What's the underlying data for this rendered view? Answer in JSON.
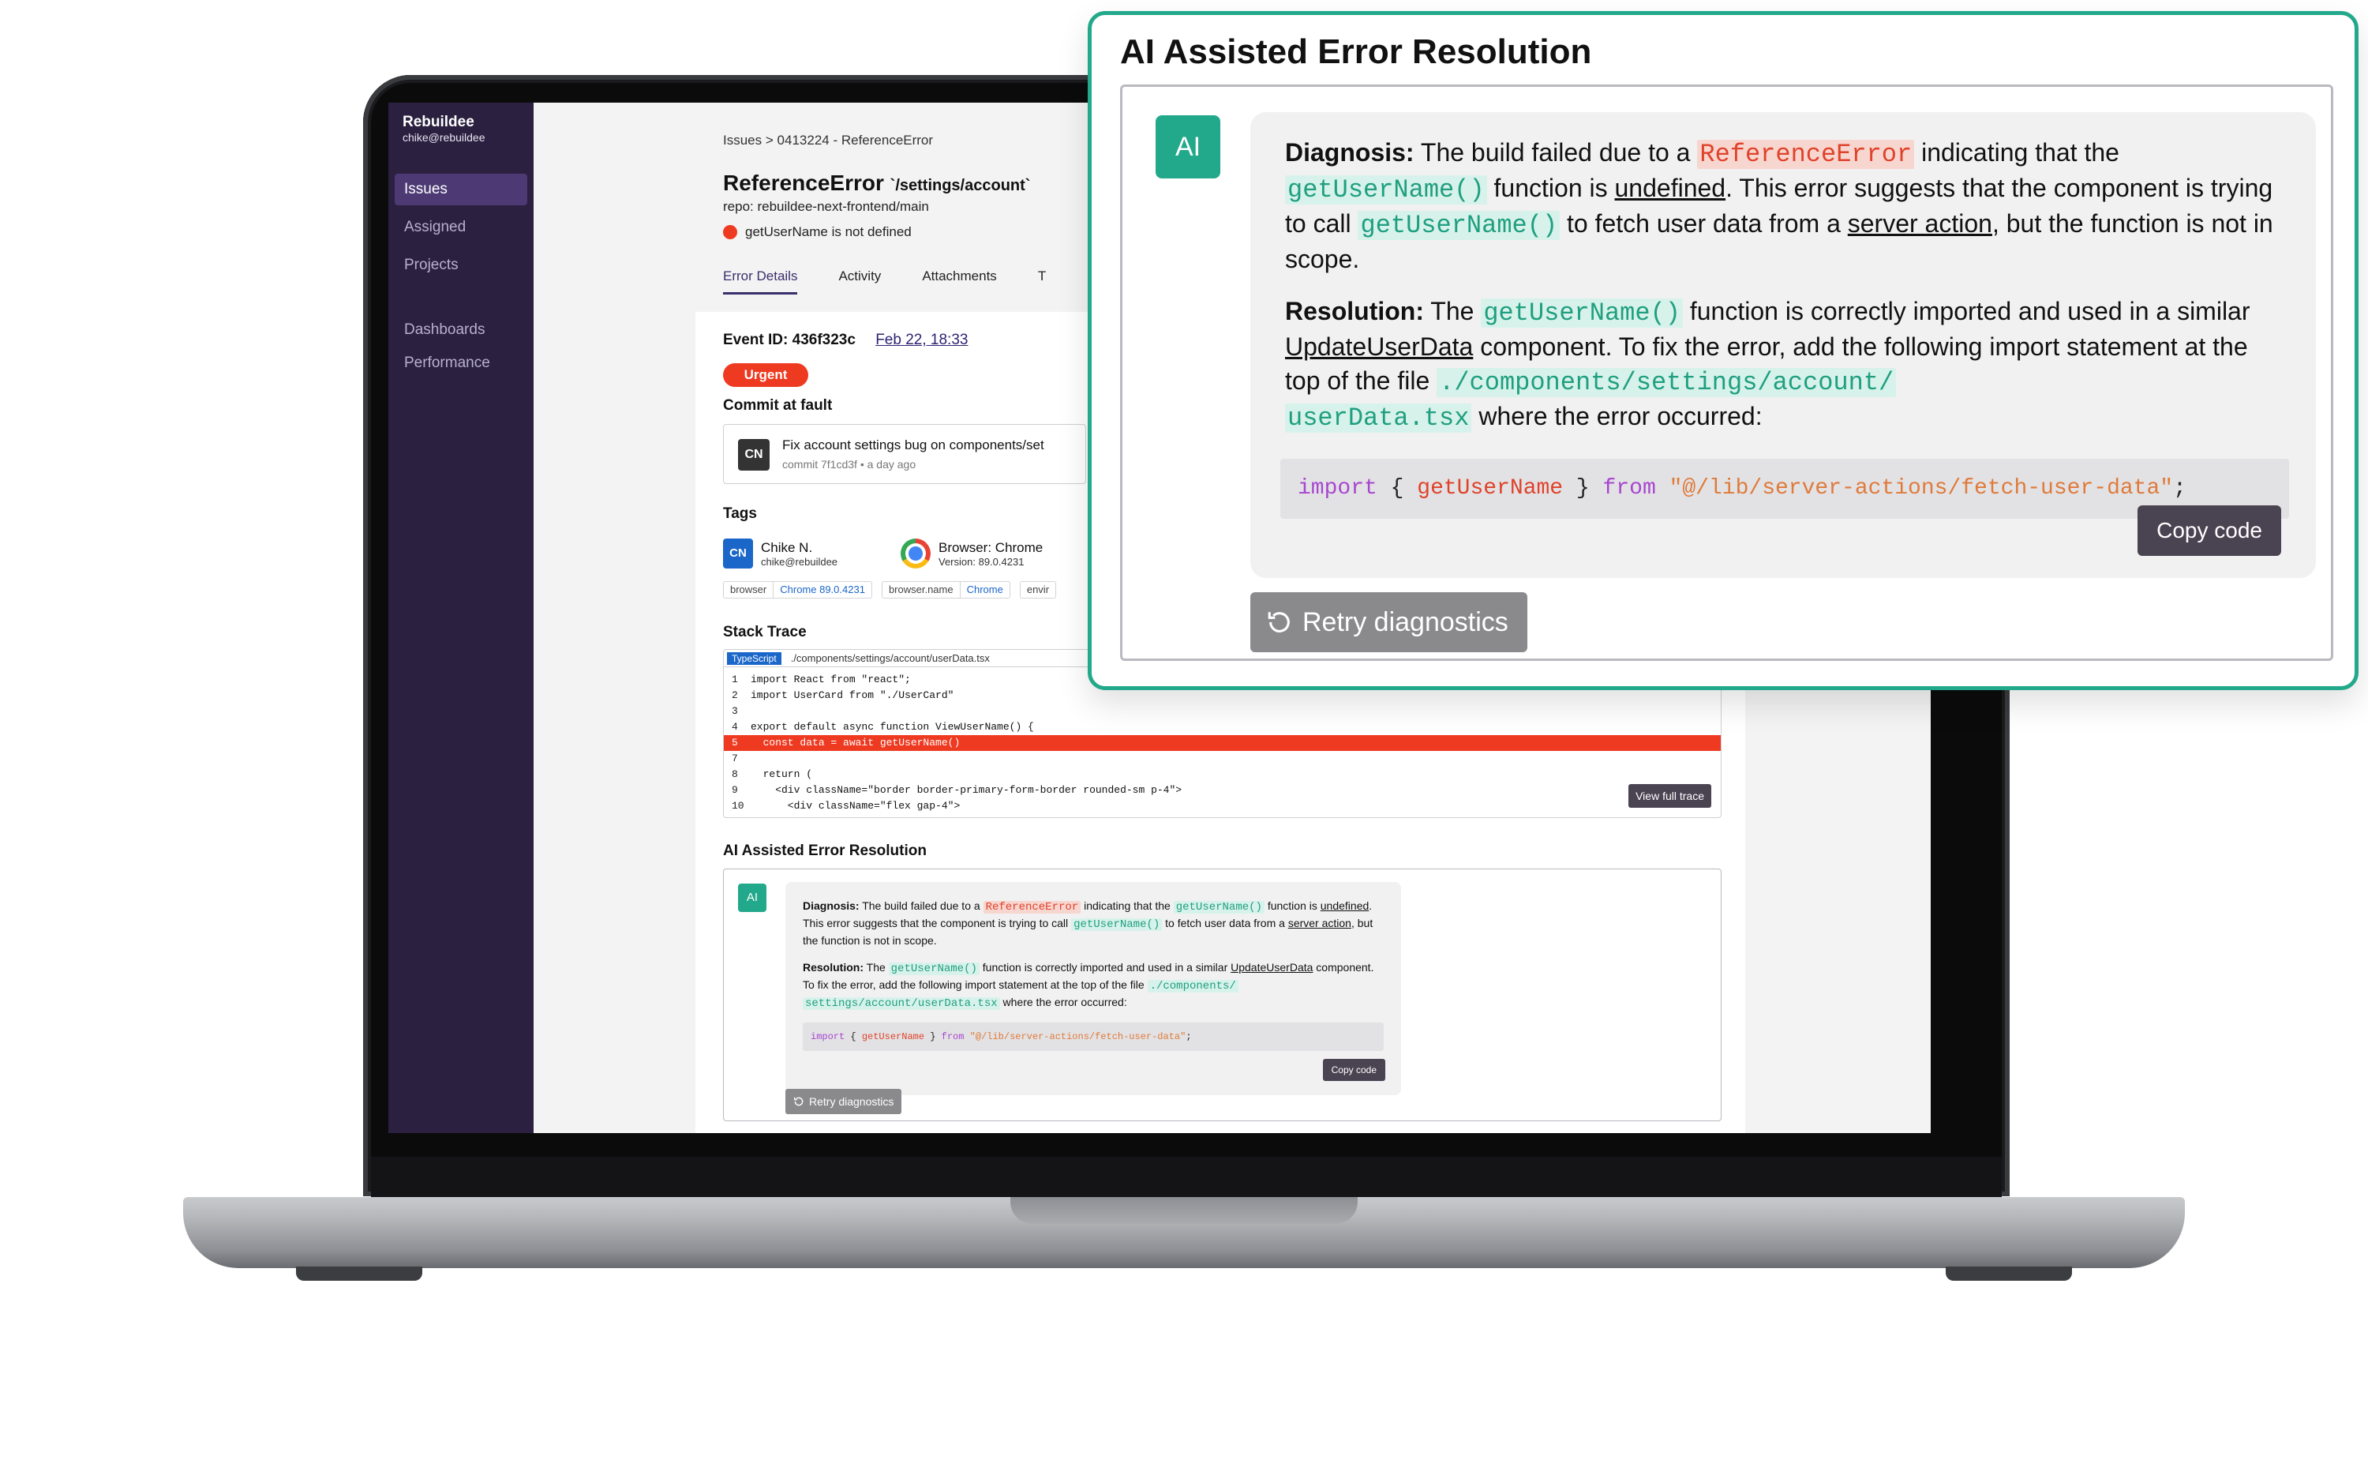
{
  "sidebar": {
    "org_name": "Rebuildee",
    "org_email": "chike@rebuildee",
    "items": [
      {
        "label": "Issues",
        "active": true
      },
      {
        "label": "Assigned"
      },
      {
        "label": "Projects"
      },
      {
        "label": "Dashboards"
      },
      {
        "label": "Performance"
      }
    ]
  },
  "breadcrumb": {
    "root": "Issues",
    "separator": ">",
    "current": "0413224 - ReferenceError"
  },
  "issue": {
    "title": "ReferenceError",
    "route": "`/settings/account`",
    "repo": "repo: rebuildee-next-frontend/main",
    "error_message": "getUserName is not defined"
  },
  "tabs": [
    "Error Details",
    "Activity",
    "Attachments",
    "T"
  ],
  "event": {
    "label": "Event ID: 436f323c",
    "date": "Feb 22, 18:33",
    "priority": "Urgent"
  },
  "commit": {
    "section_label": "Commit at fault",
    "author_initials": "CN",
    "message": "Fix account settings bug on components/set",
    "meta": "commit 7f1cd3f • a day ago"
  },
  "tags": {
    "section_label": "Tags",
    "user_initials": "CN",
    "user_name": "Chike N.",
    "user_email": "chike@rebuildee",
    "browser_label": "Browser: Chrome",
    "browser_version": "Version: 89.0.4231",
    "chips": [
      {
        "key": "browser",
        "value": "Chrome 89.0.4231"
      },
      {
        "key": "browser.name",
        "value": "Chrome"
      },
      {
        "key": "envir",
        "value": ""
      }
    ]
  },
  "stack_trace": {
    "section_label": "Stack Trace",
    "language": "TypeScript",
    "file": "./components/settings/account/userData.tsx",
    "lines": [
      {
        "n": "1",
        "code": "import React from \"react\";"
      },
      {
        "n": "2",
        "code": "import UserCard from \"./UserCard\""
      },
      {
        "n": "3",
        "code": ""
      },
      {
        "n": "4",
        "code": "export default async function ViewUserName() {"
      },
      {
        "n": "5",
        "code": "  const data = await getUserName()",
        "highlight": true
      },
      {
        "n": "7",
        "code": ""
      },
      {
        "n": "8",
        "code": "  return ("
      },
      {
        "n": "9",
        "code": "    <div className=\"border border-primary-form-border rounded-sm p-4\">"
      },
      {
        "n": "10",
        "code": "      <div className=\"flex gap-4\">"
      }
    ],
    "view_full_label": "View full trace"
  },
  "ai": {
    "section_label": "AI Assisted Error Resolution",
    "badge": "AI",
    "diagnosis_label": "Diagnosis:",
    "d1": "The build failed due to a",
    "d_err": "ReferenceError",
    "d2": "indicating that the",
    "d_fn": "getUserName()",
    "d3": "function is",
    "d_undef": "undefined",
    "d4": ". This error suggests that the component is trying to call",
    "d5": "to fetch user data from a",
    "d_sa": "server action",
    "d6": ", but the function is not in scope.",
    "resolution_label": "Resolution:",
    "r1": "The",
    "r2": "function is correctly imported and used in a similar",
    "r_comp": "UpdateUserData",
    "r3": "component. To fix the error, add the following import statement at the top of the file",
    "r_file": "./components/settings/account/userData.tsx",
    "r_file_a": "./components/",
    "r_file_b": "settings/account/userData.tsx",
    "r_file_c": "./components/settings/account/",
    "r_file_d": "userData.tsx",
    "r4": "where the error occurred:",
    "code": {
      "kw_import": "import",
      "open": "{",
      "ident": "getUserName",
      "close": "}",
      "kw_from": "from",
      "path": "\"@/lib/server-actions/fetch-user-data\"",
      "semi": ";"
    },
    "copy_label": "Copy code",
    "retry_label": "Retry diagnostics"
  },
  "colors": {
    "sidebar_bg": "#2b2040",
    "accent_green": "#22a88a",
    "error_red": "#ee3a21",
    "button_dark": "#4a4352"
  }
}
